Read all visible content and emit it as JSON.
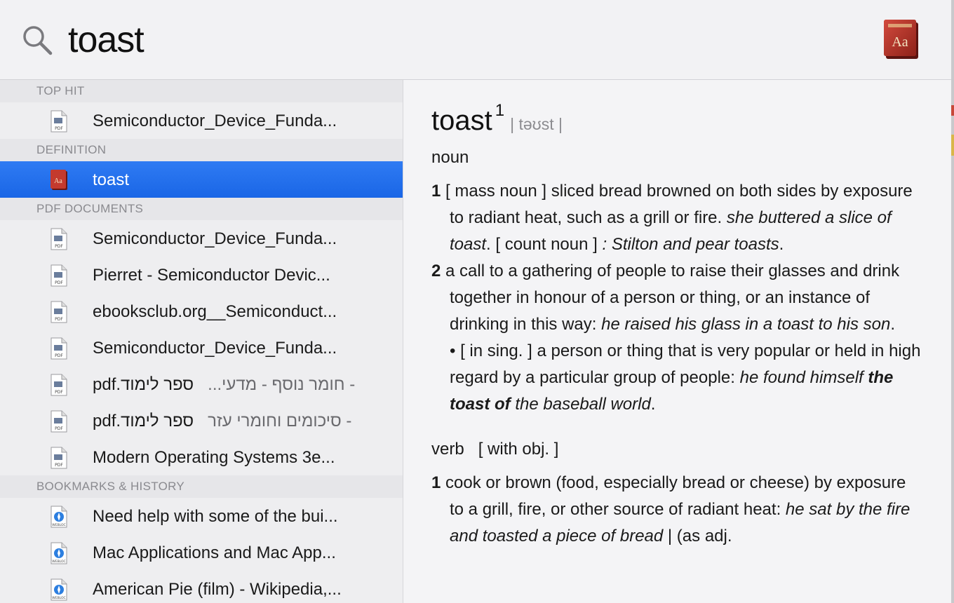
{
  "search": {
    "query": "toast"
  },
  "results": {
    "sections": [
      {
        "header": "TOP HIT",
        "items": [
          {
            "icon": "pdf",
            "label": "Semiconductor_Device_Funda..."
          }
        ]
      },
      {
        "header": "DEFINITION",
        "items": [
          {
            "icon": "dictionary",
            "label": "toast",
            "selected": true
          }
        ]
      },
      {
        "header": "PDF DOCUMENTS",
        "items": [
          {
            "icon": "pdf",
            "label": "Semiconductor_Device_Funda..."
          },
          {
            "icon": "pdf",
            "label": "Pierret  - Semiconductor Devic..."
          },
          {
            "icon": "pdf",
            "label": "ebooksclub.org__Semiconduct..."
          },
          {
            "icon": "pdf",
            "label": "Semiconductor_Device_Funda..."
          },
          {
            "icon": "pdf",
            "label": "pdf.ספר לימוד",
            "label_rtl": "- חומר נוסף - מדעי..."
          },
          {
            "icon": "pdf",
            "label": "pdf.ספר לימוד",
            "label_rtl": "- סיכומים וחומרי עזר"
          },
          {
            "icon": "pdf",
            "label": "Modern Operating Systems 3e..."
          }
        ]
      },
      {
        "header": "BOOKMARKS & HISTORY",
        "items": [
          {
            "icon": "webloc",
            "label": "Need help with some of the bui..."
          },
          {
            "icon": "webloc",
            "label": "Mac Applications and Mac App..."
          },
          {
            "icon": "webloc",
            "label": "American Pie (film) - Wikipedia,..."
          }
        ]
      }
    ]
  },
  "definition": {
    "headword": "toast",
    "homograph": "1",
    "pronunciation": "| təʊst |",
    "noun": {
      "pos": "noun",
      "s1_num": "1",
      "s1_a": " [ mass noun ] sliced bread browned on both sides by exposure to radiant heat, such as a grill or fire. ",
      "s1_ex1": "she buttered a slice of toast",
      "s1_b": ". [ count noun ] ",
      "s1_ex2": ": Stilton and pear toasts",
      "s1_c": ".",
      "s2_num": "2",
      "s2_a": " a call to a gathering of people to raise their glasses and drink together in honour of a person or thing, or an instance of drinking in this way: ",
      "s2_ex": "he raised his glass in a toast to his son",
      "s2_b": ".",
      "sub_a": "• [ in sing. ] a person or thing that is very popular or held in high regard by a particular group of people: ",
      "sub_ex1": "he found himself ",
      "sub_bold": "the toast of",
      "sub_ex2": " the baseball world",
      "sub_b": "."
    },
    "verb": {
      "pos": "verb",
      "pos_note": "[ with obj. ]",
      "s1_num": "1",
      "s1_a": " cook or brown (food, especially bread or cheese) by exposure to a grill, fire, or other source of radiant heat: ",
      "s1_ex": "he sat by the fire and toasted a piece of bread",
      "s1_b": " | (as adj."
    }
  }
}
